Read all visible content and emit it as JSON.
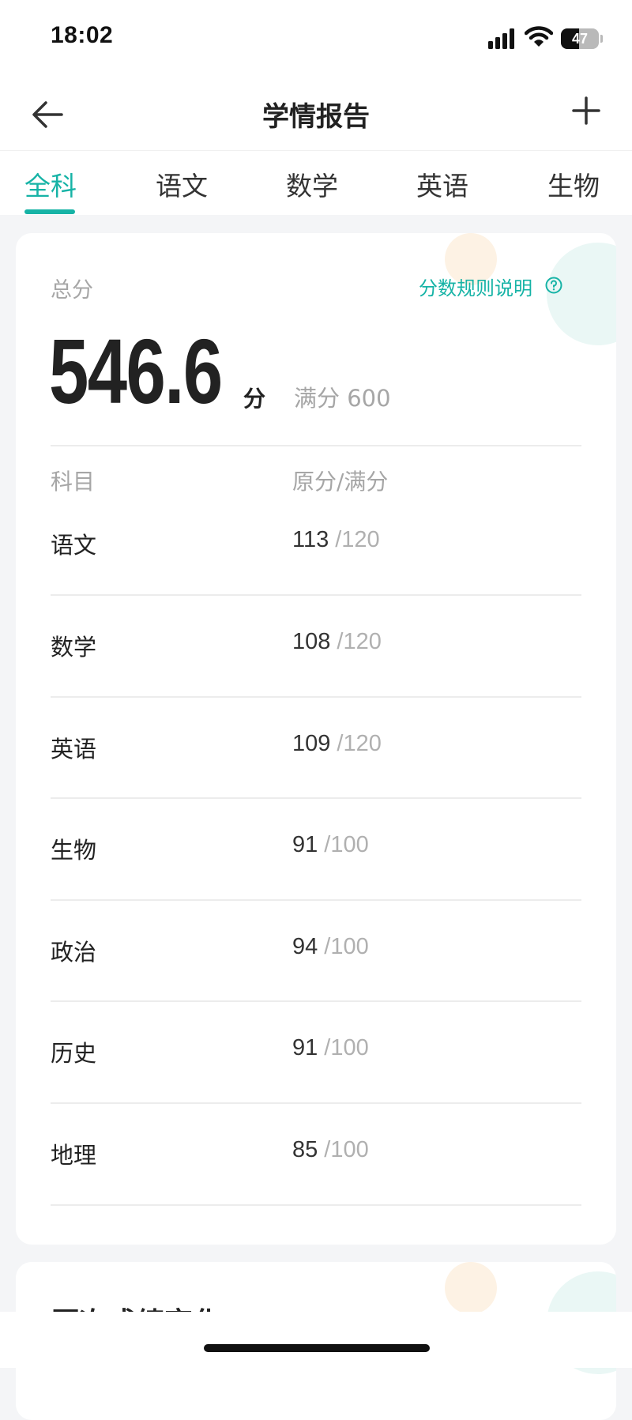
{
  "status_bar": {
    "time": "18:02",
    "battery": "47",
    "battery_level": 0.47,
    "icons": [
      "signal-icon",
      "wifi-icon",
      "battery-icon"
    ]
  },
  "nav": {
    "title": "学情报告",
    "back_icon": "back-arrow-icon",
    "plus_icon": "plus-icon"
  },
  "tabs": [
    {
      "label": "全科",
      "active": true
    },
    {
      "label": "语文",
      "active": false
    },
    {
      "label": "数学",
      "active": false
    },
    {
      "label": "英语",
      "active": false
    },
    {
      "label": "生物",
      "active": false
    }
  ],
  "summary": {
    "total_label": "总分",
    "rule_link": "分数规则说明",
    "score": "546.6",
    "score_unit": "分",
    "full_score": "满分 600"
  },
  "table": {
    "headers": [
      "科目",
      "原分/满分"
    ],
    "rows": [
      {
        "subject": "语文",
        "score": "113",
        "full": "/120"
      },
      {
        "subject": "数学",
        "score": "108",
        "full": "/120"
      },
      {
        "subject": "英语",
        "score": "109",
        "full": "/120"
      },
      {
        "subject": "生物",
        "score": "91",
        "full": "/100"
      },
      {
        "subject": "政治",
        "score": "94",
        "full": "/100"
      },
      {
        "subject": "历史",
        "score": "91",
        "full": "/100"
      },
      {
        "subject": "地理",
        "score": "85",
        "full": "/100"
      }
    ]
  },
  "history_card": {
    "title": "历次成绩变化"
  },
  "colors": {
    "accent": "#16b3a6",
    "muted_text": "#a6a6a6",
    "background": "#f4f5f7"
  }
}
